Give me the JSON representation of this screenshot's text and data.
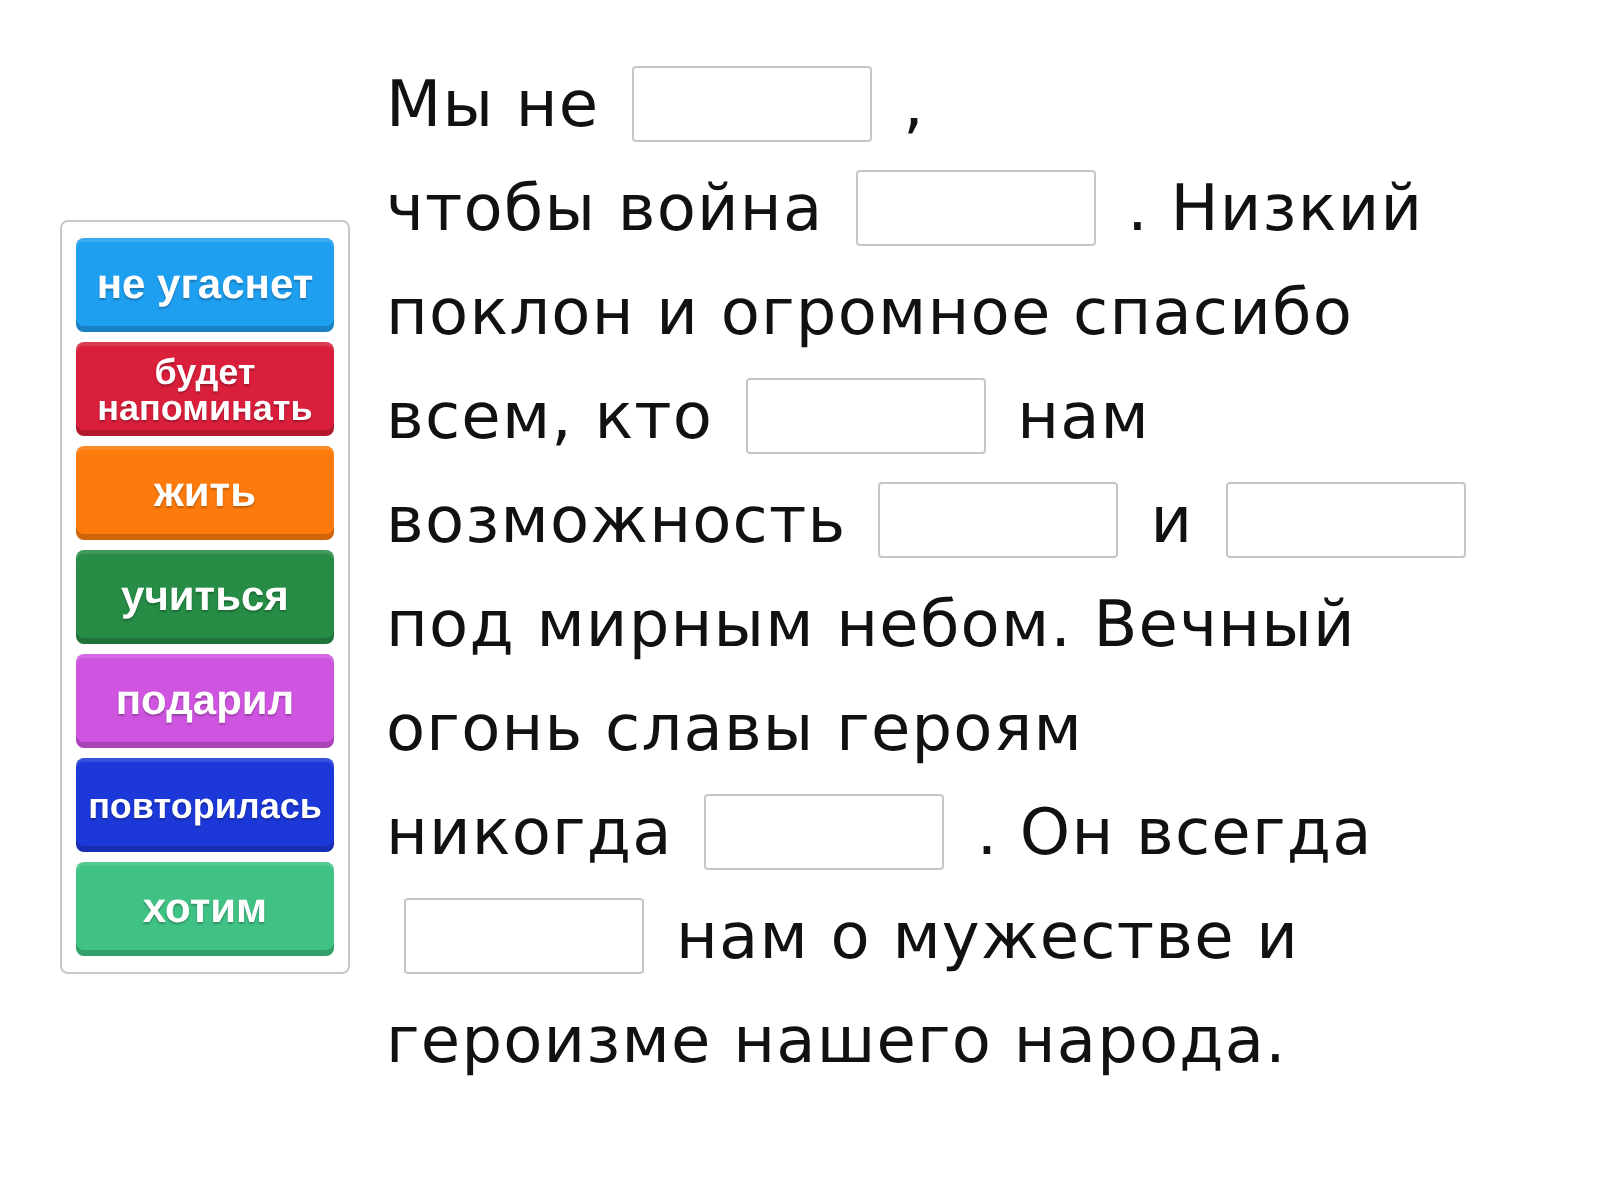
{
  "word_bank": {
    "tiles": [
      {
        "text": "не угаснет",
        "color": "#1f9ff0"
      },
      {
        "text": "будет напоминать",
        "color": "#d91f3c"
      },
      {
        "text": "жить",
        "color": "#fd7a0c"
      },
      {
        "text": "учиться",
        "color": "#268c46"
      },
      {
        "text": "подарил",
        "color": "#cf55e0"
      },
      {
        "text": "повторилась",
        "color": "#1c38d8"
      },
      {
        "text": "хотим",
        "color": "#3fc283"
      }
    ]
  },
  "passage": {
    "lines": [
      [
        {
          "kind": "text",
          "text": "Мы не"
        },
        {
          "kind": "blank"
        },
        {
          "kind": "text",
          "text": ","
        }
      ],
      [
        {
          "kind": "text",
          "text": "чтобы война"
        },
        {
          "kind": "blank"
        },
        {
          "kind": "text",
          "text": ". Низкий"
        }
      ],
      [
        {
          "kind": "text",
          "text": "поклон и огромное спасибо"
        }
      ],
      [
        {
          "kind": "text",
          "text": "всем, кто"
        },
        {
          "kind": "blank"
        },
        {
          "kind": "text",
          "text": "нам"
        }
      ],
      [
        {
          "kind": "text",
          "text": "возможность"
        },
        {
          "kind": "blank"
        },
        {
          "kind": "text",
          "text": "и"
        },
        {
          "kind": "blank"
        }
      ],
      [
        {
          "kind": "text",
          "text": "под мирным небом. Вечный"
        }
      ],
      [
        {
          "kind": "text",
          "text": "огонь славы героям"
        }
      ],
      [
        {
          "kind": "text",
          "text": "никогда"
        },
        {
          "kind": "blank"
        },
        {
          "kind": "text",
          "text": ". Он всегда"
        }
      ],
      [
        {
          "kind": "blank"
        },
        {
          "kind": "text",
          "text": "нам о мужестве и"
        }
      ],
      [
        {
          "kind": "text",
          "text": "героизме нашего народа."
        }
      ]
    ]
  }
}
